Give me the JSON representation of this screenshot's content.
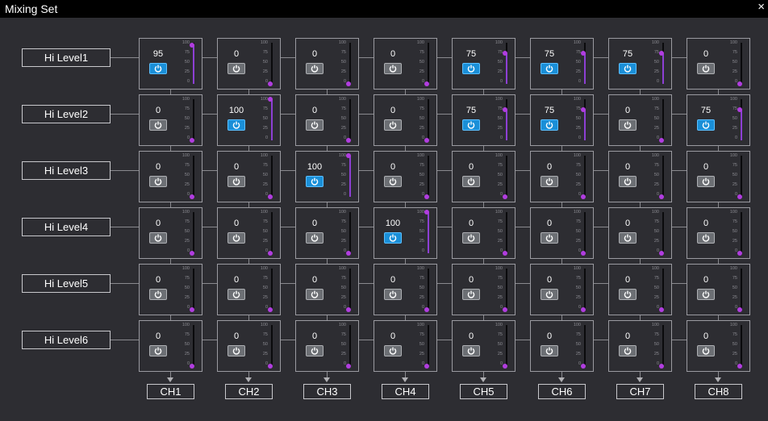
{
  "window": {
    "title": "Mixing Set",
    "close_glyph": "×"
  },
  "rows": [
    "Hi Level1",
    "Hi Level2",
    "Hi Level3",
    "Hi Level4",
    "Hi Level5",
    "Hi Level6"
  ],
  "channels": [
    "CH1",
    "CH2",
    "CH3",
    "CH4",
    "CH5",
    "CH6",
    "CH7",
    "CH8"
  ],
  "scale_labels": [
    "100",
    "75",
    "50",
    "25",
    "0"
  ],
  "values": [
    [
      95,
      0,
      0,
      0,
      75,
      75,
      75,
      0
    ],
    [
      0,
      100,
      0,
      0,
      75,
      75,
      0,
      75
    ],
    [
      0,
      0,
      100,
      0,
      0,
      0,
      0,
      0
    ],
    [
      0,
      0,
      0,
      100,
      0,
      0,
      0,
      0
    ],
    [
      0,
      0,
      0,
      0,
      0,
      0,
      0,
      0
    ],
    [
      0,
      0,
      0,
      0,
      0,
      0,
      0,
      0
    ]
  ],
  "colors": {
    "background": "#2d2d32",
    "button_on": "#1a8fd8",
    "button_off": "#6c6f74",
    "slider_knob": "#b13de0"
  },
  "icons": {
    "power_button": "power-icon",
    "close": "close-icon",
    "arrow": "arrow-down-icon"
  }
}
